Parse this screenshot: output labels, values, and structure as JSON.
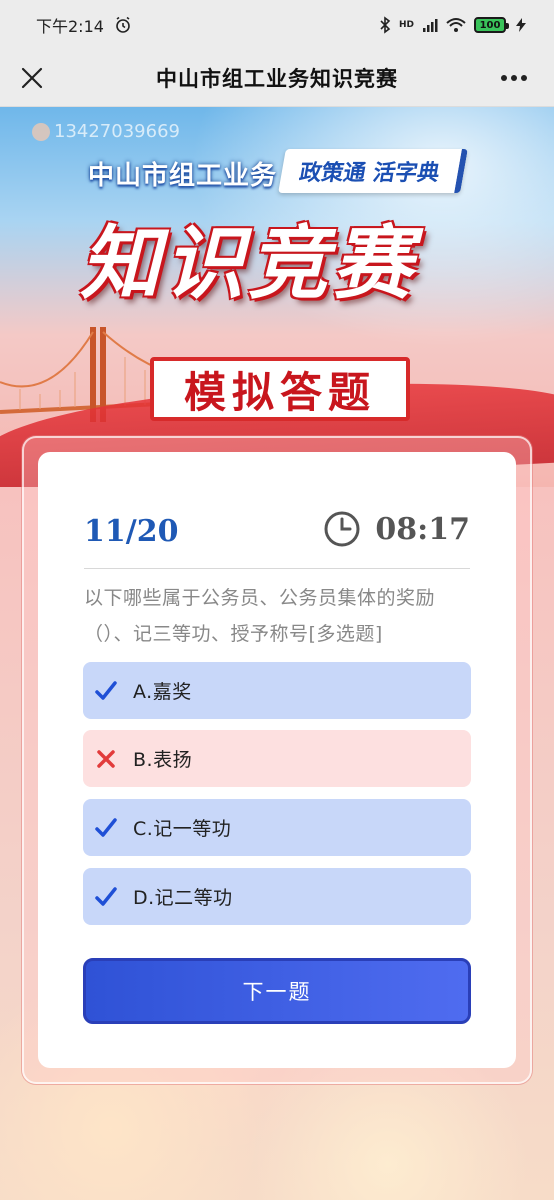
{
  "status_bar": {
    "time": "下午2:14",
    "battery": "100",
    "network_label": "HD"
  },
  "nav": {
    "title": "中山市组工业务知识竞赛",
    "close_icon": "close-icon",
    "more_icon": "more-icon"
  },
  "banner": {
    "phone": "13427039669",
    "org": "中山市组工业务",
    "tag": "政策通 活字典",
    "title": "知识竞赛",
    "subtitle": "模拟答题"
  },
  "quiz": {
    "progress": "11/20",
    "timer": "08:17",
    "question": "以下哪些属于公务员、公务员集体的奖励（）、记三等功、授予称号[多选题]",
    "options": [
      {
        "label": "A.嘉奖",
        "state": "correct",
        "icon": "check-icon"
      },
      {
        "label": "B.表扬",
        "state": "wrong",
        "icon": "cross-icon"
      },
      {
        "label": "C.记一等功",
        "state": "correct",
        "icon": "check-icon"
      },
      {
        "label": "D.记二等功",
        "state": "correct",
        "icon": "check-icon"
      }
    ],
    "next_label": "下一题"
  },
  "colors": {
    "accent_blue": "#1f59b5",
    "option_correct_bg": "#c8d7f9",
    "option_wrong_bg": "#fde0e0",
    "check": "#1f4fd6",
    "cross": "#e23b3b",
    "button": "#3a5ce2"
  }
}
